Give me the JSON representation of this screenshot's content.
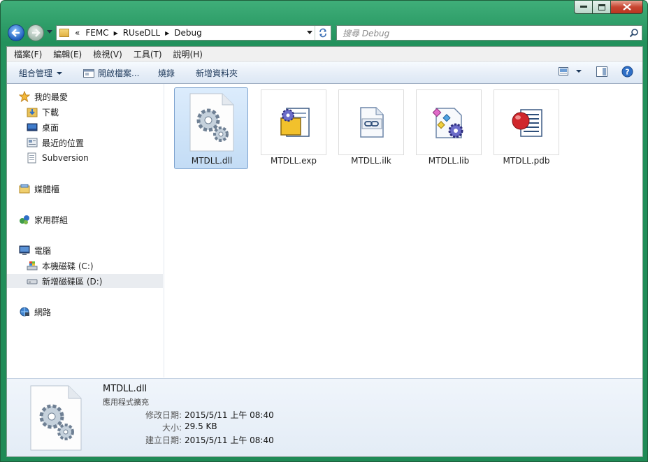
{
  "window": {
    "title": ""
  },
  "address": {
    "overflow": "«",
    "crumbs": [
      "FEMC",
      "RUseDLL",
      "Debug"
    ]
  },
  "search": {
    "placeholder": "搜尋 Debug"
  },
  "menubar": [
    "檔案(F)",
    "編輯(E)",
    "檢視(V)",
    "工具(T)",
    "說明(H)"
  ],
  "toolbar": {
    "organize": "組合管理",
    "open": "開啟檔案...",
    "burn": "燒錄",
    "new_folder": "新增資料夾"
  },
  "nav": {
    "favorites": "我的最愛",
    "downloads": "下載",
    "desktop": "桌面",
    "recent": "最近的位置",
    "subversion": "Subversion",
    "libraries": "媒體櫃",
    "homegroup": "家用群組",
    "computer": "電腦",
    "drive_c": "本機磁碟 (C:)",
    "drive_d": "新增磁碟區 (D:)",
    "network": "網路"
  },
  "files": [
    {
      "name": "MTDLL.dll",
      "icon": "dll-gear-icon"
    },
    {
      "name": "MTDLL.exp",
      "icon": "exp-file-icon"
    },
    {
      "name": "MTDLL.ilk",
      "icon": "ilk-link-icon"
    },
    {
      "name": "MTDLL.lib",
      "icon": "lib-file-icon"
    },
    {
      "name": "MTDLL.pdb",
      "icon": "pdb-file-icon"
    }
  ],
  "details": {
    "name": "MTDLL.dll",
    "type": "應用程式擴充",
    "modified_label": "修改日期:",
    "modified": "2015/5/11 上午 08:40",
    "size_label": "大小:",
    "size": "29.5 KB",
    "created_label": "建立日期:",
    "created": "2015/5/11 上午 08:40"
  },
  "colors": {
    "frame": "#22915c",
    "selection": "#cfe3f8",
    "toolbar_text": "#1e395b"
  }
}
